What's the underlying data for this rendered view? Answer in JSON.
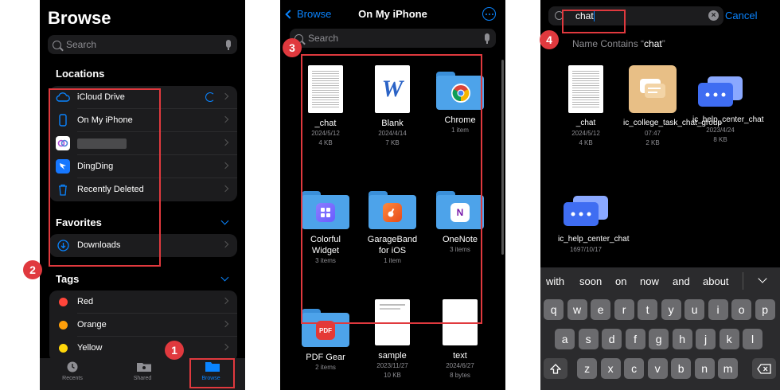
{
  "screen1": {
    "title": "Browse",
    "search_placeholder": "Search",
    "locations_header": "Locations",
    "locations": [
      {
        "label": "iCloud Drive",
        "icon": "cloud-icon"
      },
      {
        "label": "On My iPhone",
        "icon": "phone-icon"
      },
      {
        "label": "",
        "icon": "app-icon"
      },
      {
        "label": "DingDing",
        "icon": "dingding-icon"
      },
      {
        "label": "Recently Deleted",
        "icon": "trash-icon"
      }
    ],
    "favorites_header": "Favorites",
    "favorites": [
      {
        "label": "Downloads",
        "icon": "download-icon"
      }
    ],
    "tags_header": "Tags",
    "tags": [
      {
        "label": "Red",
        "color": "#ff453a"
      },
      {
        "label": "Orange",
        "color": "#ff9f0a"
      },
      {
        "label": "Yellow",
        "color": "#ffd60a"
      }
    ],
    "tabs": [
      {
        "label": "Recents",
        "icon": "clock-icon"
      },
      {
        "label": "Shared",
        "icon": "shared-folder-icon"
      },
      {
        "label": "Browse",
        "icon": "folder-icon"
      }
    ],
    "badges": [
      "1",
      "2"
    ]
  },
  "screen2": {
    "back_label": "Browse",
    "title": "On My iPhone",
    "search_placeholder": "Search",
    "badge": "3",
    "items": [
      {
        "name": "_chat",
        "meta1": "2024/5/12",
        "meta2": "4 KB",
        "kind": "doc"
      },
      {
        "name": "Blank",
        "meta1": "2024/4/14",
        "meta2": "7 KB",
        "kind": "word"
      },
      {
        "name": "Chrome",
        "meta1": "1 item",
        "meta2": "",
        "kind": "folder",
        "app": "chrome"
      },
      {
        "name": "Colorful Widget",
        "meta1": "3 items",
        "meta2": "",
        "kind": "folder",
        "app": "widget"
      },
      {
        "name": "GarageBand for iOS",
        "meta1": "1 item",
        "meta2": "",
        "kind": "folder",
        "app": "garageband"
      },
      {
        "name": "OneNote",
        "meta1": "3 items",
        "meta2": "",
        "kind": "folder",
        "app": "onenote"
      },
      {
        "name": "PDF Gear",
        "meta1": "2 items",
        "meta2": "",
        "kind": "folder",
        "app": "pdf"
      },
      {
        "name": "sample",
        "meta1": "2023/11/27",
        "meta2": "10 KB",
        "kind": "blank"
      },
      {
        "name": "text",
        "meta1": "2024/6/27",
        "meta2": "8 bytes",
        "kind": "blankwhite"
      }
    ]
  },
  "screen3": {
    "query": "chat",
    "cancel_label": "Cancel",
    "suggestion_prefix": "Name Contains “",
    "suggestion_term": "chat",
    "suggestion_suffix": "”",
    "badge": "4",
    "results": [
      {
        "name": "_chat",
        "meta1": "2024/5/12",
        "meta2": "4 KB",
        "kind": "doc"
      },
      {
        "name": "ic_college_task_chat_group",
        "meta1": "07:47",
        "meta2": "2 KB",
        "kind": "orange"
      },
      {
        "name": "ic_help_center_chat",
        "meta1": "2023/4/24",
        "meta2": "8 KB",
        "kind": "blue"
      },
      {
        "name": "ic_help_center_chat",
        "meta1": "1697/10/17",
        "meta2": "",
        "kind": "blue"
      }
    ],
    "predictions": [
      "with",
      "soon",
      "on",
      "now",
      "and",
      "about"
    ],
    "keyboard": {
      "row1": [
        "q",
        "w",
        "e",
        "r",
        "t",
        "y",
        "u",
        "i",
        "o",
        "p"
      ],
      "row2": [
        "a",
        "s",
        "d",
        "f",
        "g",
        "h",
        "j",
        "k",
        "l"
      ],
      "row3": [
        "z",
        "x",
        "c",
        "v",
        "b",
        "n",
        "m"
      ]
    }
  }
}
